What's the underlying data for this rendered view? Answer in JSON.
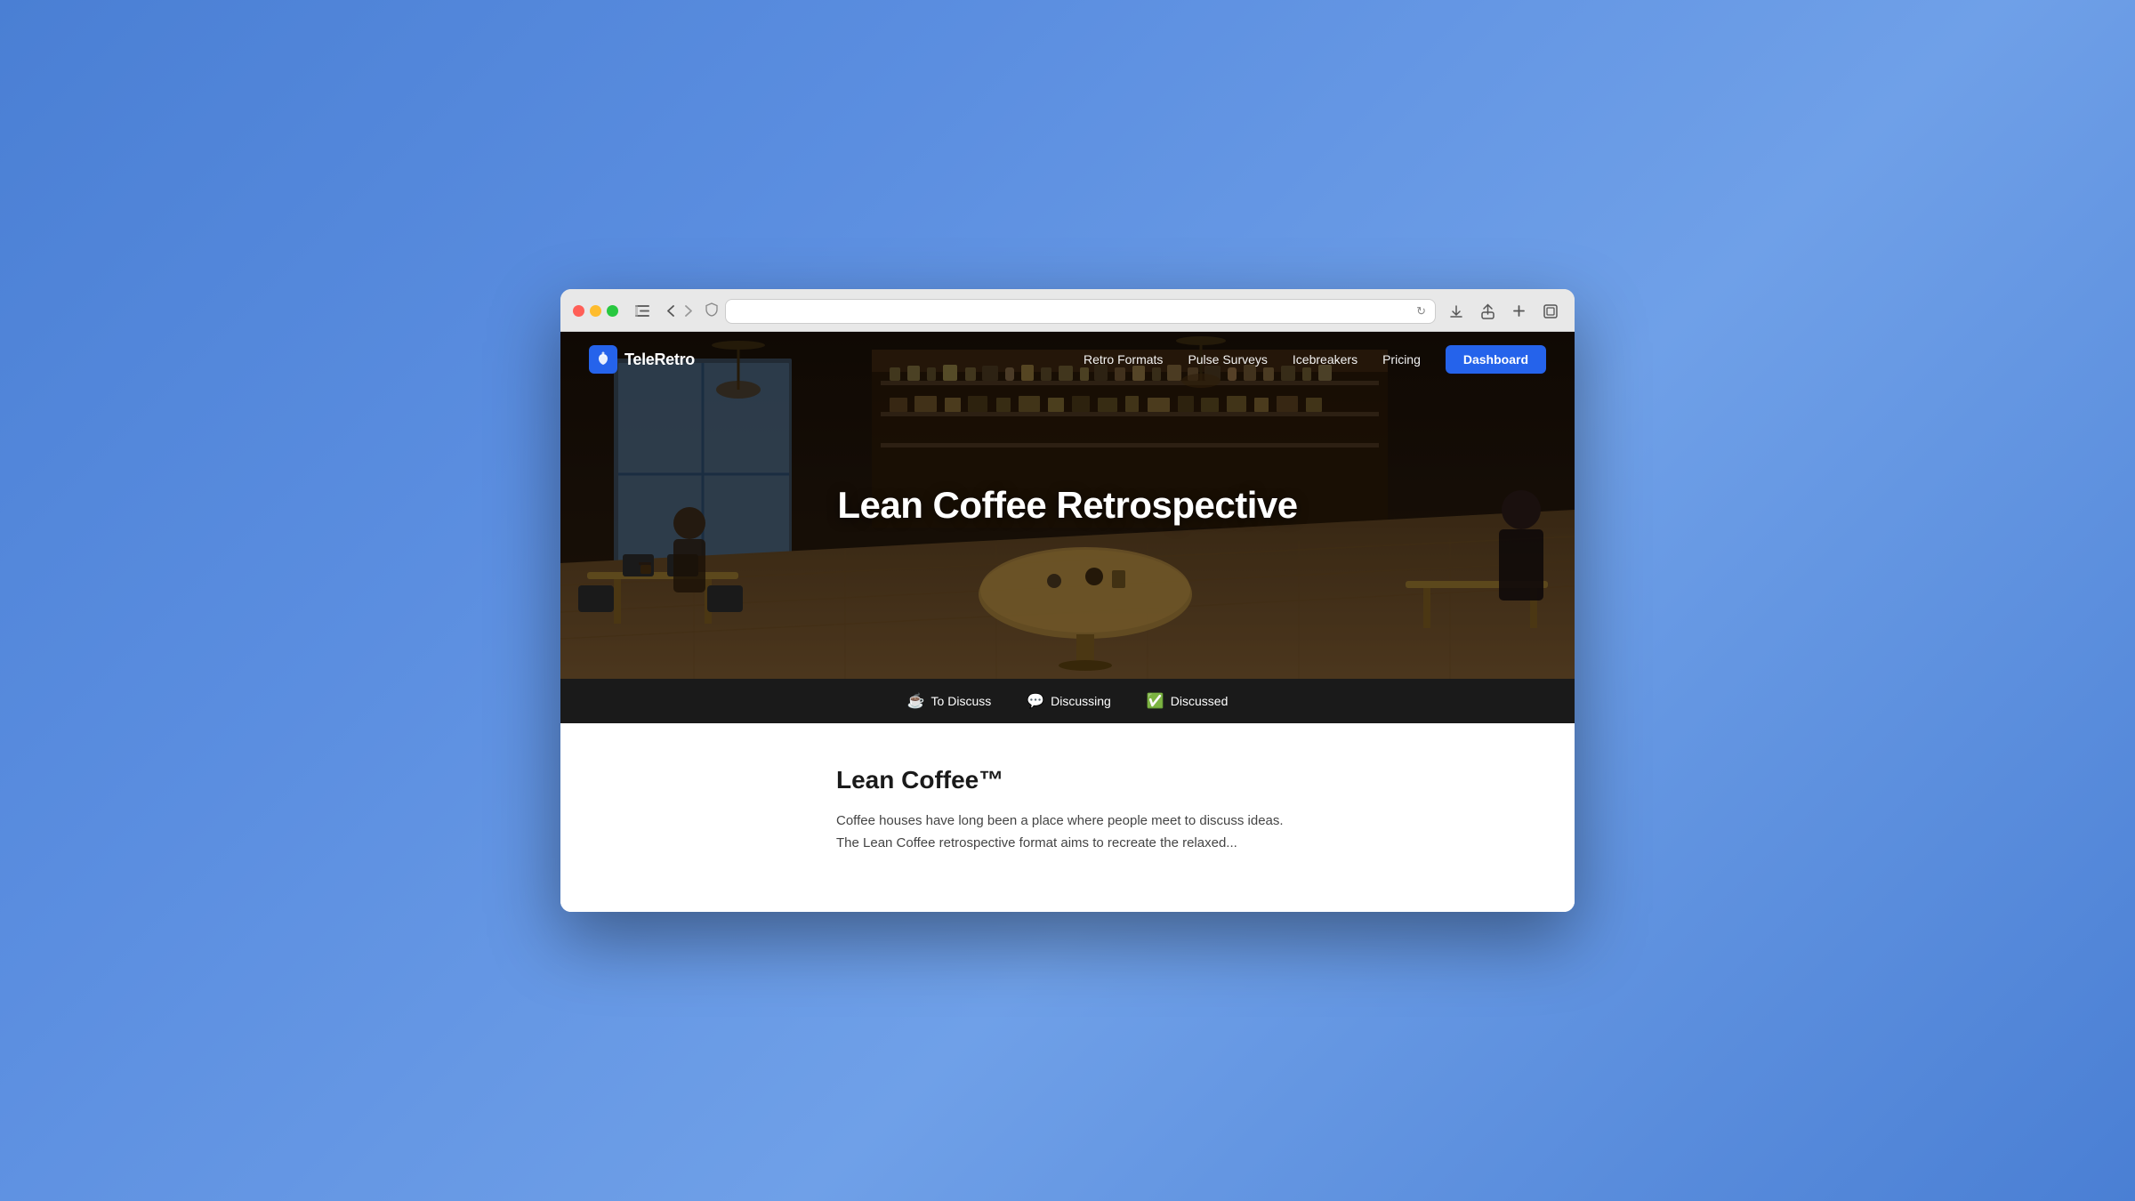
{
  "browser": {
    "traffic_lights": [
      "red",
      "yellow",
      "green"
    ],
    "address_bar_placeholder": "",
    "address_bar_value": ""
  },
  "nav": {
    "logo_text": "TeleRetro",
    "links": [
      {
        "label": "Retro Formats",
        "href": "#"
      },
      {
        "label": "Pulse Surveys",
        "href": "#"
      },
      {
        "label": "Icebreakers",
        "href": "#"
      },
      {
        "label": "Pricing",
        "href": "#"
      }
    ],
    "dashboard_button": "Dashboard"
  },
  "hero": {
    "title": "Lean Coffee Retrospective"
  },
  "status_bar": {
    "items": [
      {
        "emoji": "☕",
        "label": "To Discuss"
      },
      {
        "emoji": "💬",
        "label": "Discussing"
      },
      {
        "emoji": "✅",
        "label": "Discussed"
      }
    ]
  },
  "content": {
    "title": "Lean Coffee™",
    "text": "Coffee houses have long been a place where people meet to discuss ideas. The Lean Coffee retrospective format aims to recreate the relaxed..."
  }
}
